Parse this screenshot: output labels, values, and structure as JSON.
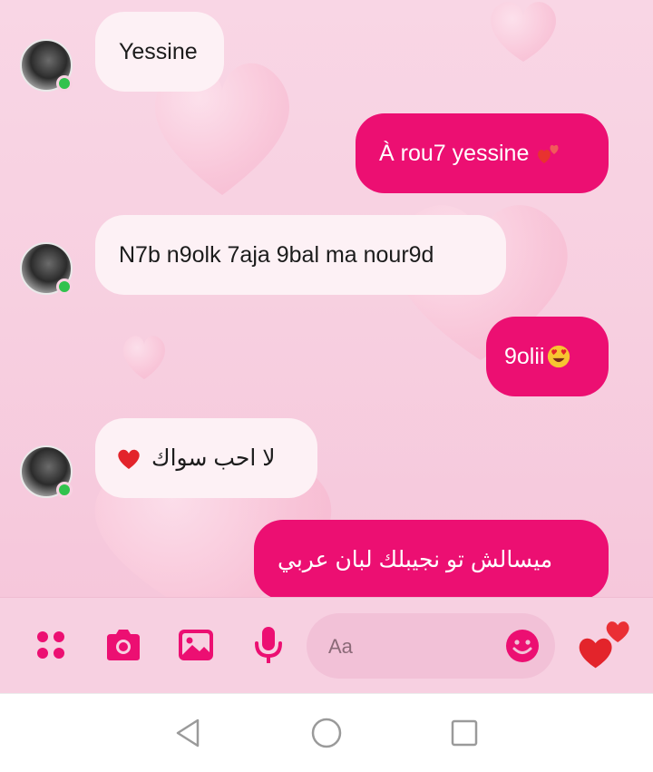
{
  "messages": [
    {
      "id": 1,
      "direction": "in",
      "text": "Yessine"
    },
    {
      "id": 2,
      "direction": "out",
      "text": "À rou7 yessine",
      "emoji": "two-hearts"
    },
    {
      "id": 3,
      "direction": "in",
      "text": "N7b n9olk 7aja 9bal ma nour9d"
    },
    {
      "id": 4,
      "direction": "out",
      "text": "9olii",
      "emoji": "heart-eyes-face"
    },
    {
      "id": 5,
      "direction": "in",
      "text": "لا احب سواك",
      "emoji": "red-heart"
    },
    {
      "id": 6,
      "direction": "out",
      "text": "ميسالش تو نجيبلك لبان عربي"
    }
  ],
  "composer": {
    "placeholder": "Aa",
    "tools": [
      "apps-icon",
      "camera-icon",
      "image-icon",
      "microphone-icon"
    ],
    "emoji_button": "smiley-icon",
    "send_reaction": "hearts-icon"
  },
  "theme": {
    "accent": "#ec0f72",
    "incoming_bubble": "#fdf1f5",
    "background": "#f8d4e3"
  },
  "navbar": {
    "buttons": [
      "back-icon",
      "home-icon",
      "recents-icon"
    ]
  }
}
